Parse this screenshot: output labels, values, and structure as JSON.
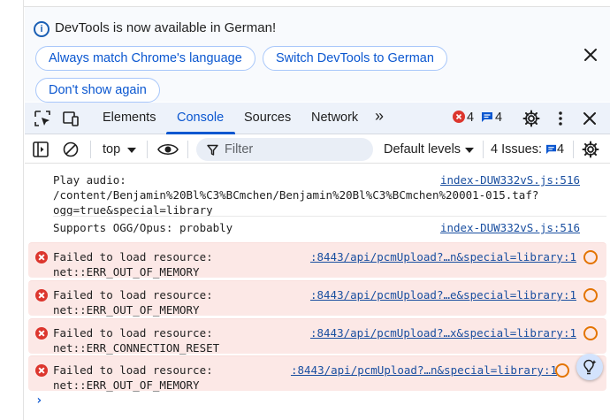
{
  "infobar": {
    "message": "DevTools is now available in German!",
    "buttons": {
      "match": "Always match Chrome's language",
      "switch": "Switch DevTools to German",
      "dont_show": "Don't show again"
    }
  },
  "tabs": {
    "elements": "Elements",
    "console": "Console",
    "sources": "Sources",
    "network": "Network",
    "more": "»"
  },
  "counts": {
    "errors": "4",
    "messages": "4"
  },
  "console_toolbar": {
    "context": "top",
    "filter_placeholder": "Filter",
    "levels": "Default levels",
    "issues_label": "4 Issues:",
    "issues_count": "4"
  },
  "messages": [
    {
      "level": "info",
      "text": "Play audio:\n/content/Benjamin%20Bl%C3%BCmchen/Benjamin%20Bl%C3%BCmchen%20001-015.taf?\nogg=true&special=library",
      "source": "index-DUW332vS.js:516"
    },
    {
      "level": "info",
      "text": "Supports OGG/Opus: probably",
      "source": "index-DUW332vS.js:516"
    },
    {
      "level": "error",
      "text": "Failed to load resource:\nnet::ERR_OUT_OF_MEMORY",
      "source": ":8443/api/pcmUpload?…n&special=library:1"
    },
    {
      "level": "error",
      "text": "Failed to load resource:\nnet::ERR_OUT_OF_MEMORY",
      "source": ":8443/api/pcmUpload?…e&special=library:1"
    },
    {
      "level": "error",
      "text": "Failed to load resource:\nnet::ERR_CONNECTION_RESET",
      "source": ":8443/api/pcmUpload?…x&special=library:1"
    },
    {
      "level": "error",
      "text": "Failed to load resource:\nnet::ERR_OUT_OF_MEMORY",
      "source": ":8443/api/pcmUpload?…n&special=library:1"
    }
  ],
  "prompt": "›",
  "colors": {
    "accent": "#0b57d0",
    "error": "#dc362e",
    "error_bg": "#fce8e6",
    "warning": "#e37400"
  }
}
